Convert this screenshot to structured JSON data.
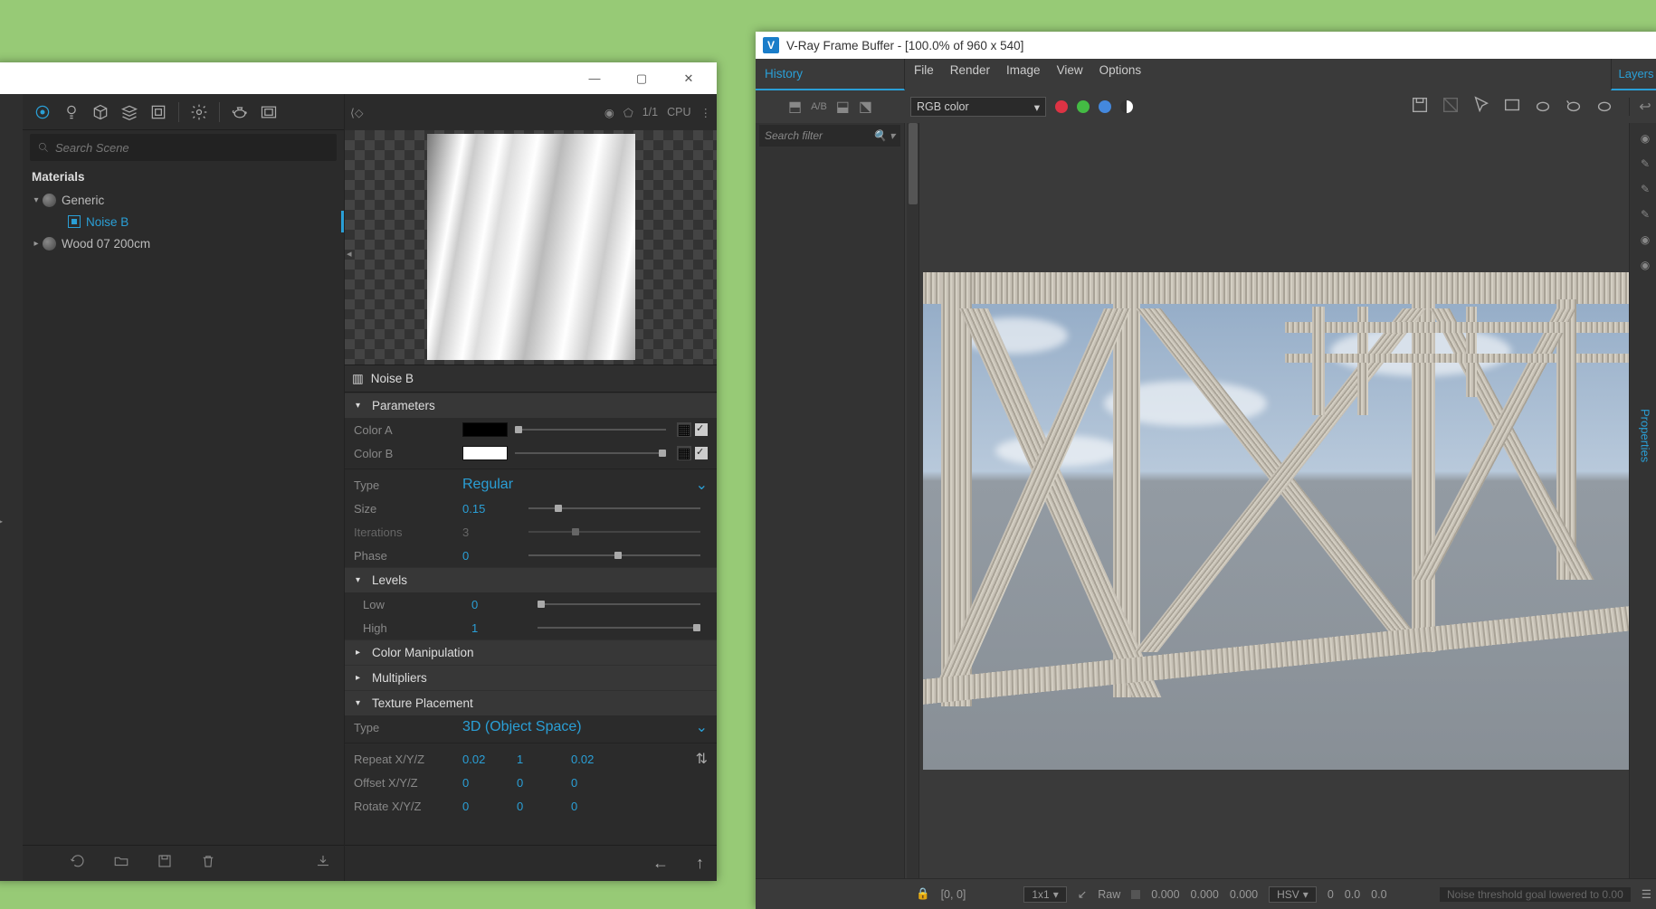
{
  "left_window": {
    "search_placeholder": "Search Scene",
    "materials_header": "Materials",
    "tree": {
      "generic": "Generic",
      "noise_b": "Noise B",
      "wood": "Wood 07 200cm"
    },
    "preview_title": "Noise B",
    "cpu_label": "CPU",
    "fraction": "1/1",
    "sections": {
      "parameters": "Parameters",
      "levels": "Levels",
      "color_manipulation": "Color Manipulation",
      "multipliers": "Multipliers",
      "texture_placement": "Texture Placement"
    },
    "params": {
      "color_a": {
        "label": "Color A",
        "value": "#000000"
      },
      "color_b": {
        "label": "Color B",
        "value": "#FFFFFF"
      },
      "type": {
        "label": "Type",
        "value": "Regular"
      },
      "size": {
        "label": "Size",
        "value": "0.15"
      },
      "iterations": {
        "label": "Iterations",
        "value": "3"
      },
      "phase": {
        "label": "Phase",
        "value": "0"
      },
      "low": {
        "label": "Low",
        "value": "0"
      },
      "high": {
        "label": "High",
        "value": "1"
      },
      "placement_type": {
        "label": "Type",
        "value": "3D (Object Space)"
      },
      "repeat": {
        "label": "Repeat X/Y/Z",
        "x": "0.02",
        "y": "1",
        "z": "0.02"
      },
      "offset": {
        "label": "Offset X/Y/Z",
        "x": "0",
        "y": "0",
        "z": "0"
      },
      "rotate": {
        "label": "Rotate X/Y/Z",
        "x": "0",
        "y": "0",
        "z": "0"
      }
    }
  },
  "right_window": {
    "title": "V-Ray Frame Buffer - [100.0% of 960 x 540]",
    "history_tab": "History",
    "layers_tab": "Layers",
    "properties_tab": "Properties",
    "menus": {
      "file": "File",
      "render": "Render",
      "image": "Image",
      "view": "View",
      "options": "Options"
    },
    "channel_combo": "RGB color",
    "search_placeholder": "Search filter",
    "status": {
      "coords": "[0, 0]",
      "grid": "1x1",
      "raw": "Raw",
      "val1": "0.000",
      "val2": "0.000",
      "val3": "0.000",
      "mode": "HSV",
      "h": "0",
      "s": "0.0",
      "v": "0.0",
      "msg": "Noise threshold goal lowered to 0.00"
    }
  }
}
